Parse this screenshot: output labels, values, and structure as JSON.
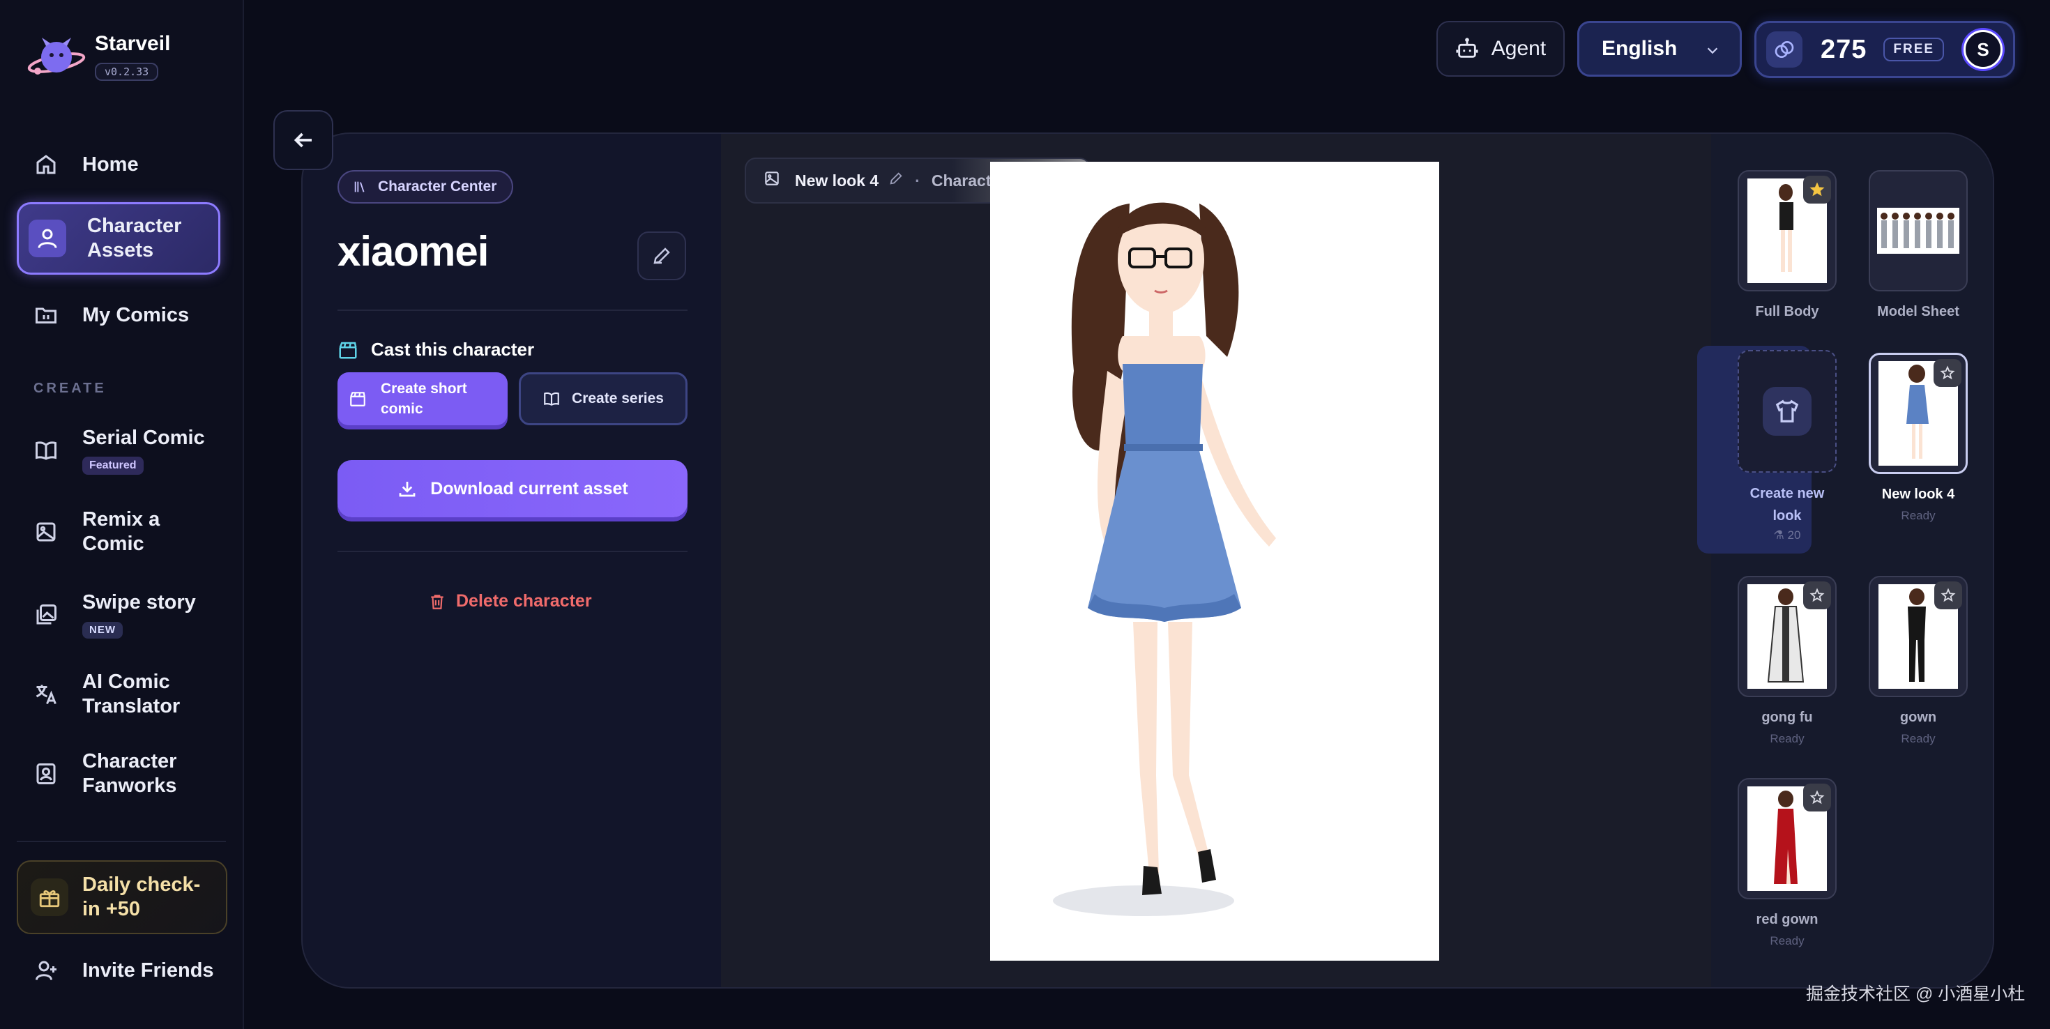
{
  "brand": {
    "name": "Starveil",
    "version": "v0.2.33"
  },
  "sidebar": {
    "items": [
      {
        "label": "Home",
        "icon": "home-icon"
      },
      {
        "label": "Character Assets",
        "icon": "user-icon",
        "active": true
      },
      {
        "label": "My Comics",
        "icon": "folder-icon"
      }
    ],
    "section_label": "CREATE",
    "create_items": [
      {
        "label": "Serial Comic",
        "badge": "Featured",
        "icon": "book-icon"
      },
      {
        "label": "Remix a Comic",
        "icon": "image-icon"
      },
      {
        "label": "Swipe story",
        "badge": "NEW",
        "icon": "gallery-icon"
      },
      {
        "label": "AI Comic Translator",
        "icon": "translate-icon"
      },
      {
        "label": "Character Fanworks",
        "icon": "portrait-icon"
      }
    ],
    "checkin_label": "Daily check-in +50",
    "invite_label": "Invite Friends"
  },
  "topbar": {
    "agent_label": "Agent",
    "language": "English",
    "credits": "275",
    "plan": "FREE",
    "avatar_letter": "S"
  },
  "character": {
    "center_chip": "Character Center",
    "name": "xiaomei",
    "cast_label": "Cast this character",
    "create_short_label": "Create short comic",
    "create_series_label": "Create series",
    "download_label": "Download current asset",
    "delete_label": "Delete character"
  },
  "breadcrumb": {
    "current": "New look 4",
    "parent": "Character assets"
  },
  "looks": [
    {
      "name": "Full Body",
      "status": "",
      "starred": true
    },
    {
      "name": "Model Sheet",
      "status": ""
    },
    {
      "name": "New look 4",
      "status": "Ready",
      "selected": true
    },
    {
      "name": "gong fu",
      "status": "Ready"
    },
    {
      "name": "gown",
      "status": "Ready"
    },
    {
      "name": "red gown",
      "status": "Ready"
    }
  ],
  "create_look": {
    "label": "Create new look",
    "cost": "20"
  },
  "watermark": "掘金技术社区 @ 小酒星小杜",
  "colors": {
    "accent": "#7c5cf3",
    "danger": "#f06b6b",
    "dress": "#5b82c4"
  }
}
